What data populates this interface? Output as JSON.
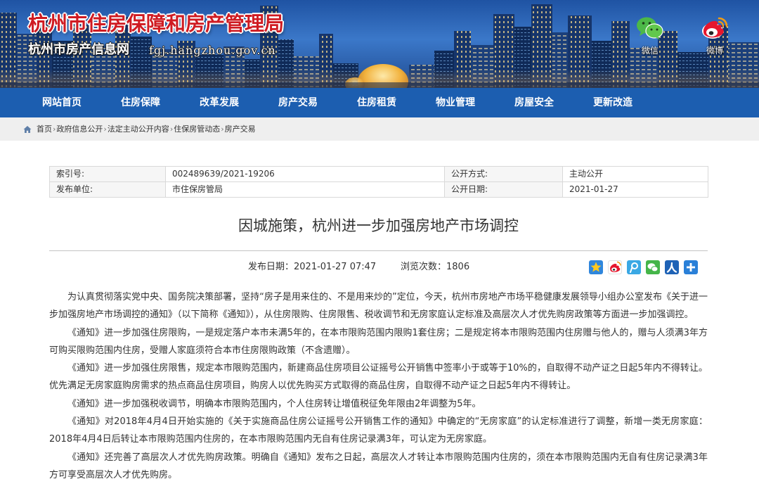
{
  "header": {
    "site_title": "杭州市住房保障和房产管理局",
    "site_subtitle": "杭州市房产信息网",
    "site_domain": "fgj.hangzhou.gov.cn",
    "social": [
      {
        "icon": "wechat-icon",
        "label": "微信"
      },
      {
        "icon": "weibo-icon",
        "label": "微博"
      }
    ]
  },
  "nav": {
    "items": [
      "网站首页",
      "住房保障",
      "改革发展",
      "房产交易",
      "住房租赁",
      "物业管理",
      "房屋安全",
      "更新改造"
    ]
  },
  "breadcrumb": {
    "home_icon": "home-icon",
    "separator": "›",
    "items": [
      "首页",
      "政府信息公开",
      "法定主动公开内容",
      "住保房管动态",
      "房产交易"
    ]
  },
  "info_table": {
    "index_no": {
      "label": "索引号:",
      "value": "002489639/2021-19206"
    },
    "disclosure_method": {
      "label": "公开方式:",
      "value": "主动公开"
    },
    "publisher": {
      "label": "发布单位:",
      "value": "市住保房管局"
    },
    "disclosure_date": {
      "label": "公开日期:",
      "value": "2021-01-27"
    }
  },
  "article": {
    "title": "因城施策，杭州进一步加强房地产市场调控",
    "publish_label": "发布日期：",
    "publish_datetime": "2021-01-27 07:47",
    "views_label": "浏览次数：",
    "views": "1806",
    "share_icons": [
      "qzone-icon",
      "sina-weibo-icon",
      "tencent-weibo-icon",
      "wechat-share-icon",
      "renren-icon",
      "more-share-icon"
    ],
    "paragraphs": [
      "为认真贯彻落实党中央、国务院决策部署，坚持“房子是用来住的、不是用来炒的”定位，今天，杭州市房地产市场平稳健康发展领导小组办公室发布《关于进一步加强房地产市场调控的通知》（以下简称《通知》），从住房限购、住房限售、税收调节和无房家庭认定标准及高层次人才优先购房政策等方面进一步加强调控。",
      "《通知》进一步加强住房限购，一是规定落户本市未满5年的，在本市限购范围内限购1套住房；二是规定将本市限购范围内住房赠与他人的，赠与人须满3年方可购买限购范围内住房，受赠人家庭须符合本市住房限购政策（不含遗赠）。",
      "《通知》进一步加强住房限售，规定本市限购范围内，新建商品住房项目公证摇号公开销售中签率小于或等于10%的，自取得不动产证之日起5年内不得转让。优先满足无房家庭购房需求的热点商品住房项目，购房人以优先购买方式取得的商品住房，自取得不动产证之日起5年内不得转让。",
      "《通知》进一步加强税收调节，明确本市限购范围内，个人住房转让增值税征免年限由2年调整为5年。",
      "《通知》对2018年4月4日开始实施的《关于实施商品住房公证摇号公开销售工作的通知》中确定的“无房家庭”的认定标准进行了调整，新增一类无房家庭：2018年4月4日后转让本市限购范围内住房的，在本市限购范围内无自有住房记录满3年，可认定为无房家庭。",
      "《通知》还完善了高层次人才优先购房政策。明确自《通知》发布之日起，高层次人才转让本市限购范围内住房的，须在本市限购范围内无自有住房记录满3年方可享受高层次人才优先购房。"
    ]
  },
  "colors": {
    "nav_bg": "#1c5eb0",
    "breadcrumb_bg": "#efefef",
    "site_title": "#cf1b22",
    "body_text": "#333333",
    "table_border": "#d9d9d9",
    "table_label_bg": "#f6f6f6",
    "rule": "#c4c4c4"
  }
}
